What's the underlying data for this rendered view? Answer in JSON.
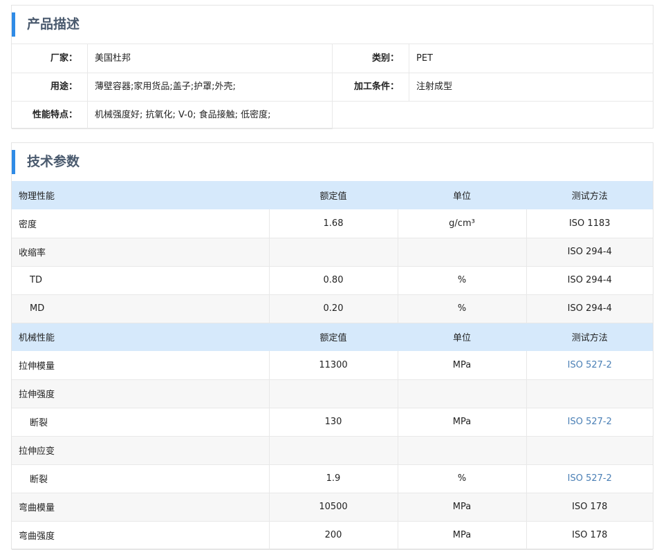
{
  "product_desc": {
    "title": "产品描述",
    "rows": [
      [
        {
          "label": "厂家：",
          "value": "美国杜邦"
        },
        {
          "label": "类别：",
          "value": "PET"
        }
      ],
      [
        {
          "label": "用途：",
          "value": "薄壁容器;家用货品;盖子;护罩;外壳;"
        },
        {
          "label": "加工条件：",
          "value": "注射成型"
        }
      ],
      [
        {
          "label": "性能特点：",
          "value": "机械强度好; 抗氧化; V-0; 食品接触; 低密度;"
        }
      ]
    ]
  },
  "tech": {
    "title": "技术参数",
    "header_physical": [
      "物理性能",
      "额定值",
      "单位",
      "测试方法"
    ],
    "physical": [
      {
        "name": "密度",
        "value": "1.68",
        "unit": "g/cm³",
        "method": "ISO 1183"
      },
      {
        "name": "收缩率",
        "value": "",
        "unit": "",
        "method": "ISO 294-4"
      },
      {
        "name": "TD",
        "value": "0.80",
        "unit": "%",
        "method": "ISO 294-4"
      },
      {
        "name": "MD",
        "value": "0.20",
        "unit": "%",
        "method": "ISO 294-4"
      }
    ],
    "header_mechanical": [
      "机械性能",
      "额定值",
      "单位",
      "测试方法"
    ],
    "mechanical": [
      {
        "name": "拉伸模量",
        "value": "11300",
        "unit": "MPa",
        "method": "ISO 527-2"
      },
      {
        "name": "拉伸强度",
        "value": "",
        "unit": "",
        "method": ""
      },
      {
        "name": "断裂",
        "value": "130",
        "unit": "MPa",
        "method": "ISO 527-2"
      },
      {
        "name": "拉伸应变",
        "value": "",
        "unit": "",
        "method": ""
      },
      {
        "name": "断裂",
        "value": "1.9",
        "unit": "%",
        "method": "ISO 527-2"
      },
      {
        "name": "弯曲模量",
        "value": "10500",
        "unit": "MPa",
        "method": "ISO 178"
      },
      {
        "name": "弯曲强度",
        "value": "200",
        "unit": "MPa",
        "method": "ISO 178"
      }
    ]
  },
  "colors": {
    "accent": "#2f8be6",
    "header_bg": "#d6e9fb",
    "link": "#4a7fb5"
  }
}
